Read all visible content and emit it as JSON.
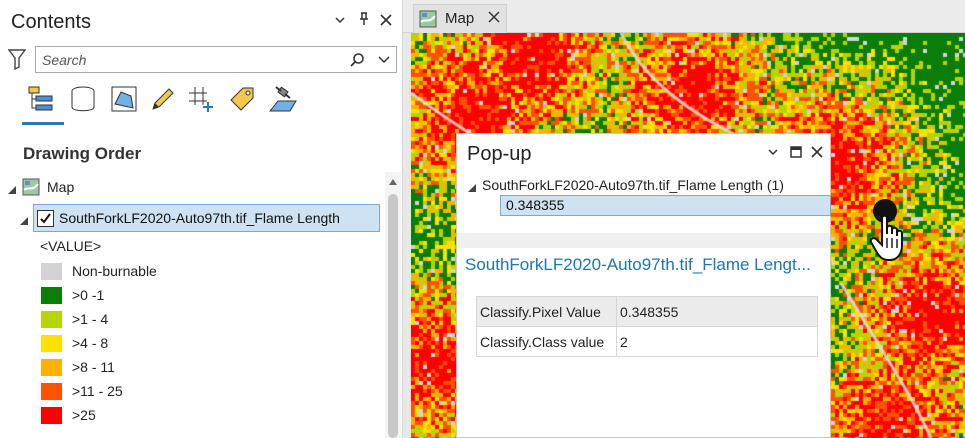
{
  "contents": {
    "title": "Contents",
    "search_placeholder": "Search",
    "tools": [
      "list-by-drawing-order",
      "list-by-data-source",
      "list-by-selection",
      "list-by-editing",
      "list-by-snapping",
      "list-by-labeling",
      "list-by-perspective-imagery"
    ],
    "section_title": "Drawing Order",
    "map_node": "Map",
    "layer": {
      "name": "SouthForkLF2020-Auto97th.tif_Flame Length",
      "checked": true
    },
    "value_field": "<VALUE>",
    "legend": [
      {
        "label": "Non-burnable",
        "color": "#d3d3d3"
      },
      {
        "label": ">0 -1",
        "color": "#0a7d0a"
      },
      {
        "label": ">1 - 4",
        "color": "#b8d400"
      },
      {
        "label": ">4 - 8",
        "color": "#ffe000"
      },
      {
        "label": ">8 - 11",
        "color": "#ffb000"
      },
      {
        "label": ">11 - 25",
        "color": "#ff5200"
      },
      {
        "label": ">25",
        "color": "#ff0000"
      }
    ]
  },
  "map": {
    "tab_label": "Map"
  },
  "popup": {
    "title": "Pop-up",
    "layer_item": "SouthForkLF2020-Auto97th.tif_Flame Length (1)",
    "selected_value": "0.348355",
    "link_title": "SouthForkLF2020-Auto97th.tif_Flame Lengt...",
    "rows": [
      {
        "key": "Classify.Pixel Value",
        "value": "0.348355"
      },
      {
        "key": "Classify.Class value",
        "value": "2"
      }
    ]
  },
  "colors": {
    "accent": "#2e75b6",
    "selection": "#cfe2f3",
    "link": "#1f73b7"
  }
}
